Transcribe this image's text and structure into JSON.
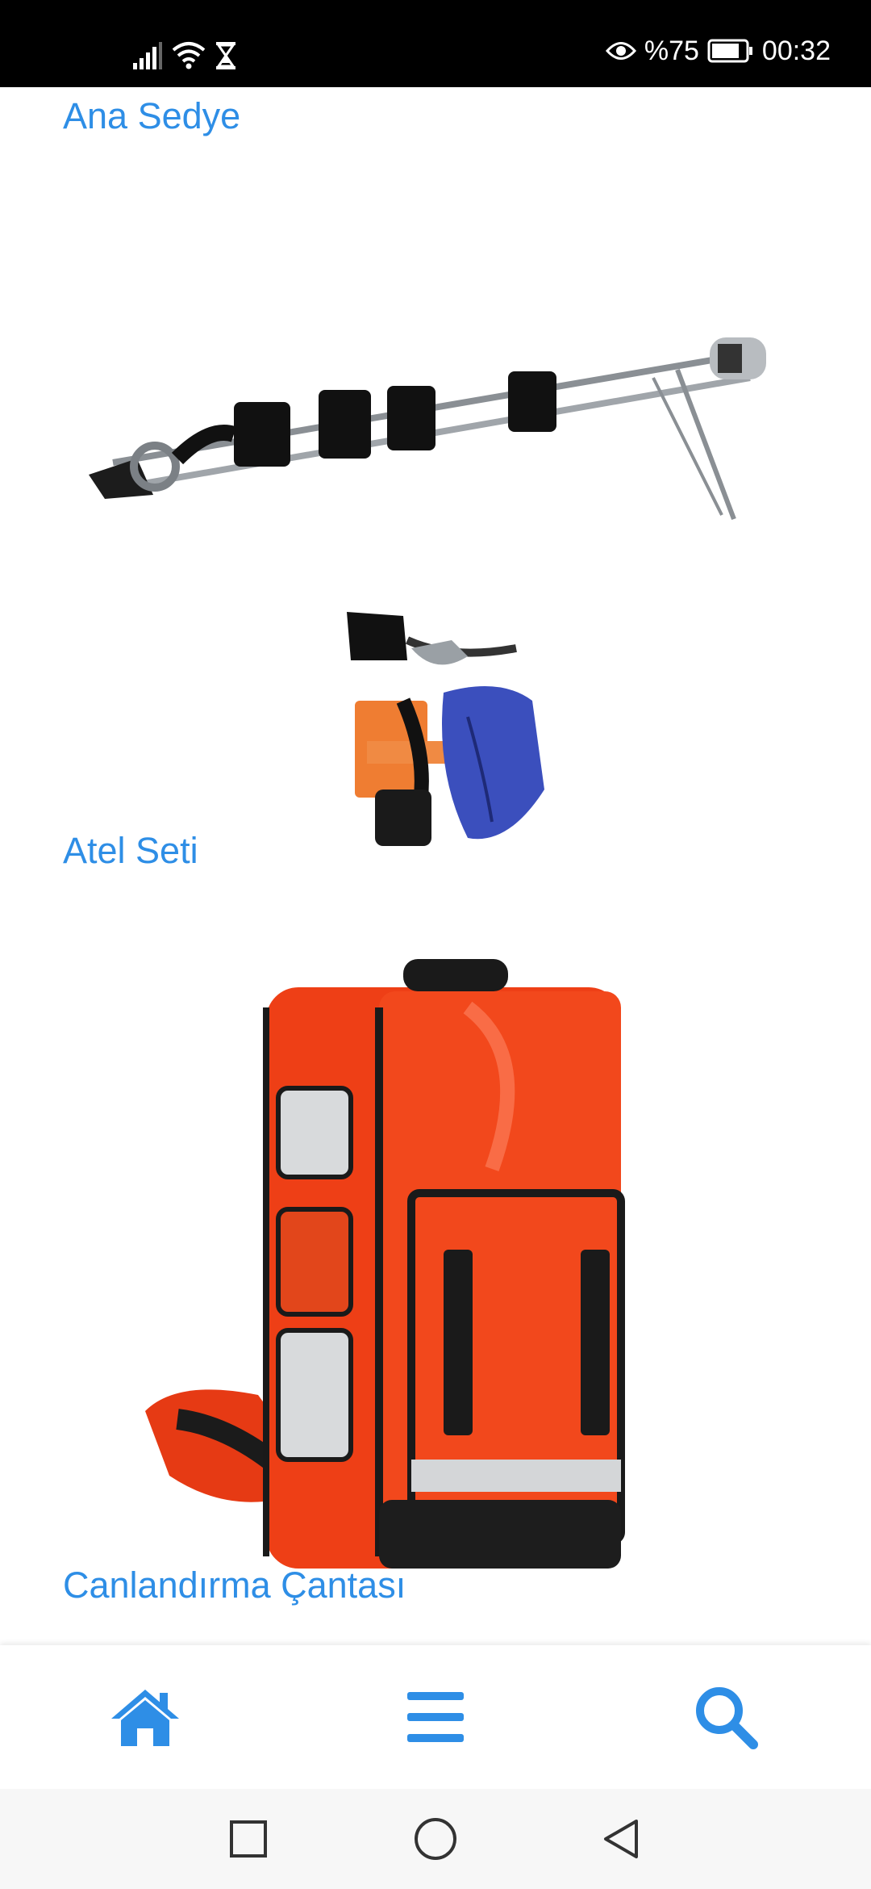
{
  "status_bar": {
    "battery_percent": "%75",
    "time": "00:32",
    "icons": [
      "signal-icon",
      "wifi-icon",
      "hourglass-icon",
      "eye-icon",
      "battery-icon"
    ]
  },
  "products": [
    {
      "title": "Ana Sedye"
    },
    {
      "title": "Atel Seti"
    },
    {
      "title": "Canlandırma Çantası"
    }
  ],
  "bottom_nav": {
    "icons": [
      "home-icon",
      "menu-icon",
      "search-icon"
    ],
    "accent": "#2e8ee6"
  },
  "system_nav": {
    "icons": [
      "recent-apps-icon",
      "home-circle-icon",
      "back-icon"
    ]
  }
}
